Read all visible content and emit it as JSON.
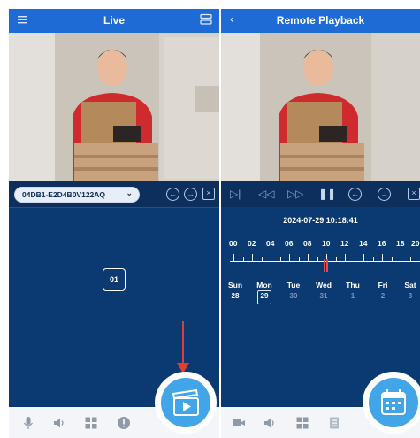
{
  "live": {
    "title": "Live",
    "device_id": "04DB1-E2D4B0V122AQ",
    "channel": "01",
    "bottom_icons": [
      "microphone-icon",
      "speaker-icon",
      "grid-icon",
      "alert-icon"
    ],
    "fab_icon": "playback-clapper-icon",
    "accent_color": "#1e6bd6",
    "annotation_color": "#e0402a"
  },
  "playback": {
    "title": "Remote Playback",
    "datetime": "2024-07-29 10:18:41",
    "hours": [
      "00",
      "02",
      "04",
      "06",
      "08",
      "10",
      "12",
      "14",
      "16",
      "18",
      "20"
    ],
    "weekdays": [
      "Sun",
      "Mon",
      "Tue",
      "Wed",
      "Thu",
      "Fri",
      "Sat"
    ],
    "days": [
      "28",
      "29",
      "30",
      "31",
      "1",
      "2",
      "3"
    ],
    "selected_day": "29",
    "bottom_icons": [
      "camera-icon",
      "speaker-icon",
      "grid-icon",
      "list-icon"
    ],
    "fab_icon": "calendar-icon"
  }
}
